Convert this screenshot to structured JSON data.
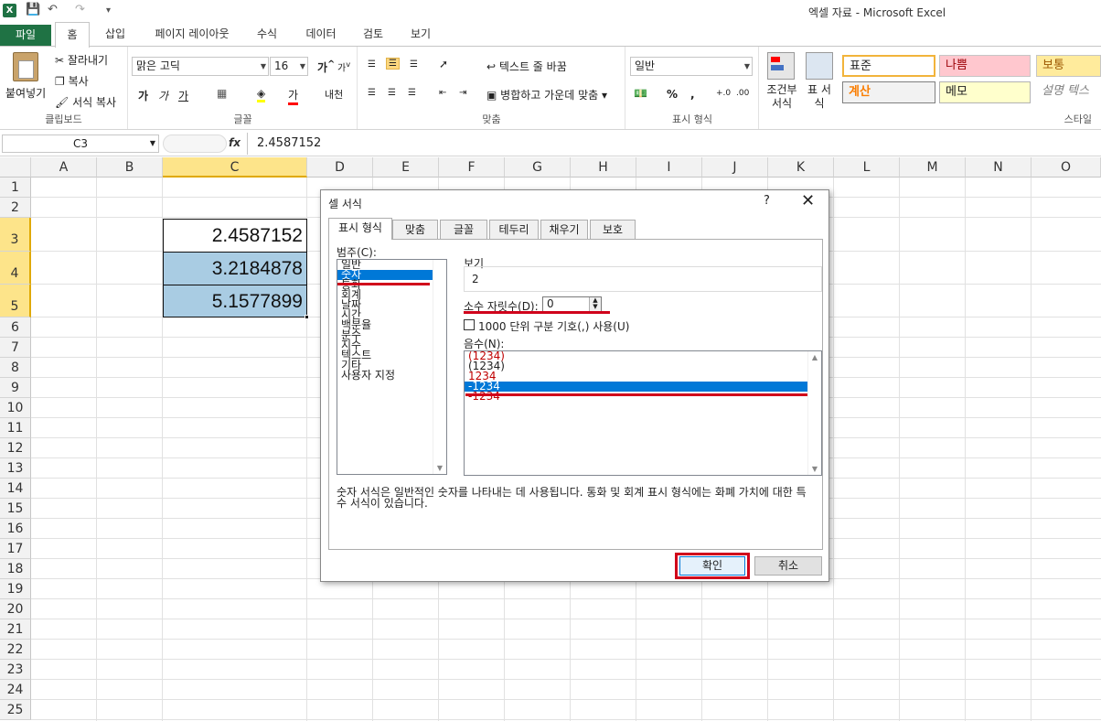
{
  "app": {
    "title": "엑셀 자료 - Microsoft Excel"
  },
  "ribbon": {
    "tabs": [
      "파일",
      "홈",
      "삽입",
      "페이지 레이아웃",
      "수식",
      "데이터",
      "검토",
      "보기"
    ],
    "clipboard": {
      "paste": "붙여넣기",
      "cut": "잘라내기",
      "copy": "복사",
      "format_painter": "서식 복사",
      "label": "클립보드"
    },
    "font": {
      "name": "맑은 고딕",
      "size": "16",
      "bold": "가",
      "italic": "가",
      "underline": "가",
      "label": "글꼴"
    },
    "align": {
      "wrap": "텍스트 줄 바꿈",
      "merge": "병합하고 가운데 맞춤",
      "label": "맞춤"
    },
    "number": {
      "format": "일반",
      "percent": "%",
      "comma": ",",
      "label": "표시 형식"
    },
    "styles": {
      "cond_format": "조건부 서식",
      "table_format": "표 서식",
      "items": [
        {
          "label": "표준",
          "bg": "#ffffff",
          "color": "#000000"
        },
        {
          "label": "나쁨",
          "bg": "#ffc7ce",
          "color": "#9c0006"
        },
        {
          "label": "보통",
          "bg": "#ffeb9c",
          "color": "#9c5700"
        },
        {
          "label": "계산",
          "bg": "#f2f2f2",
          "color": "#fa7d00"
        },
        {
          "label": "메모",
          "bg": "#ffffcc",
          "color": "#000000"
        },
        {
          "label": "설명 텍스",
          "bg": "#ffffff",
          "color": "#7f7f7f"
        }
      ],
      "label": "스타일"
    }
  },
  "formula_bar": {
    "name_box": "C3",
    "fx": "fx",
    "value": "2.4587152"
  },
  "sheet": {
    "columns": [
      "A",
      "B",
      "C",
      "D",
      "E",
      "F",
      "G",
      "H",
      "I",
      "J",
      "K",
      "L",
      "M",
      "N",
      "O"
    ],
    "rows": [
      "1",
      "2",
      "3",
      "4",
      "5",
      "6",
      "7",
      "8",
      "9",
      "10",
      "11",
      "12",
      "13",
      "14",
      "15",
      "16",
      "17",
      "18",
      "19",
      "20",
      "21",
      "22",
      "23",
      "24",
      "25"
    ],
    "cells": {
      "c3": "2.4587152",
      "c4": "3.2184878",
      "c5": "5.1577899"
    }
  },
  "dialog": {
    "title": "셀 서식",
    "help": "?",
    "close": "✕",
    "tabs": [
      "표시 형식",
      "맞춤",
      "글꼴",
      "테두리",
      "채우기",
      "보호"
    ],
    "category_label": "범주(C):",
    "categories": [
      "일반",
      "숫자",
      "통화",
      "회계",
      "날짜",
      "시간",
      "백분율",
      "분수",
      "지수",
      "텍스트",
      "기타",
      "사용자 지정"
    ],
    "preview_label": "보기",
    "preview_value": "2",
    "decimal_label": "소수 자릿수(D):",
    "decimal_value": "0",
    "thousands_label": "1000 단위 구분 기호(,) 사용(U)",
    "negative_label": "음수(N):",
    "negatives": [
      "(1234)",
      "(1234)",
      "1234",
      "-1234",
      "-1234"
    ],
    "description": "숫자 서식은 일반적인 숫자를 나타내는 데 사용됩니다. 통화 및 회계 표시 형식에는 화폐 가치에 대한 특수 서식이 있습니다.",
    "ok": "확인",
    "cancel": "취소"
  }
}
